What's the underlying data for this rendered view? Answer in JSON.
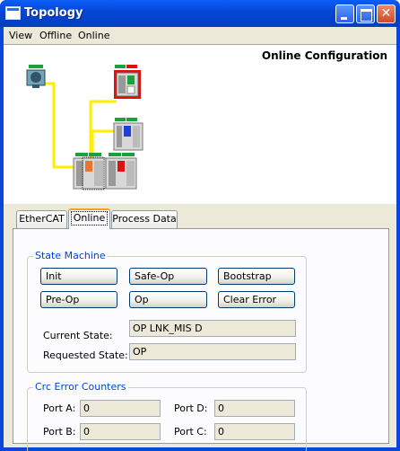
{
  "window": {
    "title": "Topology"
  },
  "menu": {
    "items": [
      "View",
      "Offline",
      "Online"
    ]
  },
  "topology": {
    "title": "Online Configuration"
  },
  "tabs": {
    "items": [
      "EtherCAT",
      "Online",
      "Process Data"
    ],
    "active": "Online"
  },
  "state_machine": {
    "title": "State Machine",
    "buttons": {
      "init": "Init",
      "safe_op": "Safe-Op",
      "bootstrap": "Bootstrap",
      "pre_op": "Pre-Op",
      "op": "Op",
      "clear_error": "Clear Error"
    },
    "current_state_label": "Current State:",
    "current_state_value": "OP LNK_MIS D",
    "requested_state_label": "Requested State:",
    "requested_state_value": "OP"
  },
  "crc": {
    "title": "Crc Error Counters",
    "port_a_label": "Port A:",
    "port_a_value": "0",
    "port_b_label": "Port B:",
    "port_b_value": "0",
    "port_c_label": "Port C:",
    "port_c_value": "0",
    "port_d_label": "Port D:",
    "port_d_value": "0"
  },
  "colors": {
    "title_bar": "#0a46d8",
    "link_line": "#ffee00",
    "status_green": "#17a33a",
    "status_red": "#e01010",
    "group_title": "#0046d5",
    "active_tab_accent": "#f3a31c"
  },
  "icons": [
    "window-app-icon",
    "minimize-icon",
    "maximize-icon",
    "close-icon",
    "master-device-icon",
    "terminal-block-icon"
  ]
}
